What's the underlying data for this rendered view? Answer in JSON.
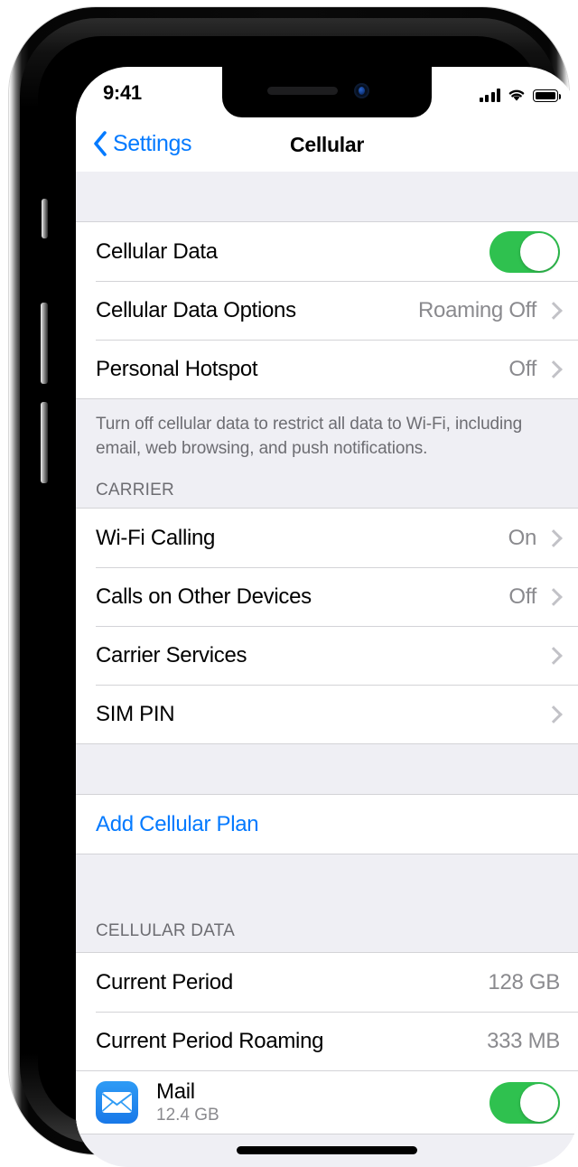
{
  "device": {
    "buttons": {
      "mute": "mute-switch",
      "volume_up": "volume-up",
      "volume_down": "volume-down",
      "power": "side-power"
    }
  },
  "status_bar": {
    "time": "9:41",
    "signal_icon": "cellular-signal-icon",
    "signal_bars_filled": 4,
    "wifi_icon": "wifi-icon",
    "battery_icon": "battery-icon",
    "battery_level_percent": 100
  },
  "nav_bar": {
    "back_label": "Settings",
    "back_icon": "chevron-left-icon",
    "title": "Cellular"
  },
  "sections": {
    "data_group": {
      "rows": [
        {
          "label": "Cellular Data",
          "type": "toggle",
          "value": "On",
          "toggle_on": true
        },
        {
          "label": "Cellular Data Options",
          "type": "disclosure",
          "value": "Roaming Off"
        },
        {
          "label": "Personal Hotspot",
          "type": "disclosure",
          "value": "Off"
        }
      ],
      "footer": "Turn off cellular data to restrict all data to Wi-Fi, including email, web browsing, and push notifications."
    },
    "carrier": {
      "header": "CARRIER",
      "rows": [
        {
          "label": "Wi-Fi Calling",
          "type": "disclosure",
          "value": "On"
        },
        {
          "label": "Calls on Other Devices",
          "type": "disclosure",
          "value": "Off"
        },
        {
          "label": "Carrier Services",
          "type": "disclosure",
          "value": ""
        },
        {
          "label": "SIM PIN",
          "type": "disclosure",
          "value": ""
        }
      ]
    },
    "add_plan": {
      "rows": [
        {
          "label": "Add Cellular Plan",
          "type": "link",
          "value": ""
        }
      ]
    },
    "cellular_data": {
      "header": "CELLULAR DATA",
      "rows": [
        {
          "label": "Current Period",
          "type": "value",
          "value": "128 GB"
        },
        {
          "label": "Current Period Roaming",
          "type": "value",
          "value": "333 MB"
        }
      ],
      "apps": [
        {
          "name": "Mail",
          "usage": "12.4 GB",
          "icon": "mail-app-icon",
          "toggle_on": true
        }
      ]
    }
  },
  "colors": {
    "accent_blue": "#047AFF",
    "toggle_green": "#2FC14F",
    "group_background": "#FFFFFF",
    "page_background": "#EFEFF4",
    "secondary_text": "#8A8A8E",
    "separator": "#D3D3D7",
    "chevron": "#C2C2C7"
  },
  "home_indicator": "home-indicator"
}
